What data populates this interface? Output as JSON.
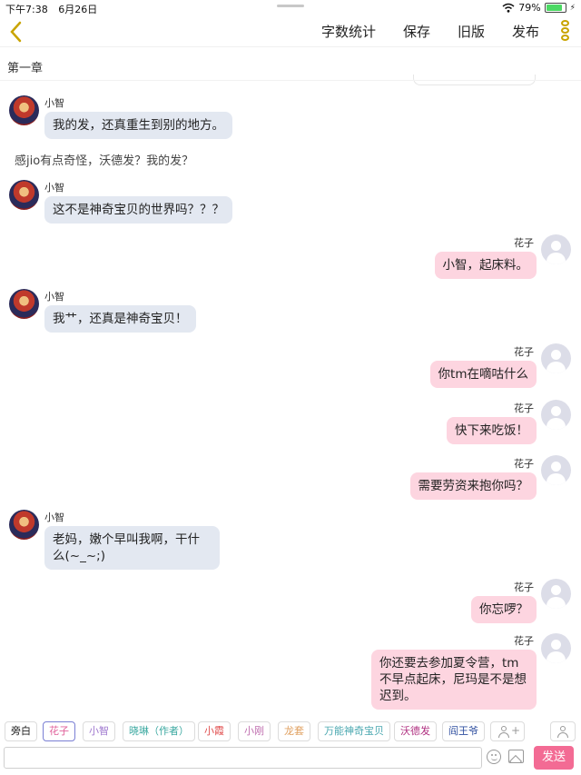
{
  "status_bar": {
    "time": "下午7:38",
    "date": "6月26日",
    "battery_text": "79%",
    "battery_level": 0.79
  },
  "toolbar": {
    "word_count": "字数统计",
    "save": "保存",
    "old_version": "旧版",
    "publish": "发布"
  },
  "chapter_title": "第一章",
  "messages": [
    {
      "side": "left",
      "name": "小智",
      "text": "我的发，还真重生到别的地方。"
    },
    {
      "side": "narration",
      "text": "感jio有点奇怪，沃德发？我的发？"
    },
    {
      "side": "left",
      "name": "小智",
      "text": "这不是神奇宝贝的世界吗？？？"
    },
    {
      "side": "right",
      "name": "花子",
      "text": "小智，起床料。"
    },
    {
      "side": "left",
      "name": "小智",
      "text": "我艹，还真是神奇宝贝！"
    },
    {
      "side": "right",
      "name": "花子",
      "text": "你tm在嘀咕什么"
    },
    {
      "side": "right",
      "name": "花子",
      "text": "快下来吃饭！"
    },
    {
      "side": "right",
      "name": "花子",
      "text": "需要劳资来抱你吗？"
    },
    {
      "side": "left",
      "name": "小智",
      "text": "老妈，嫩个早叫我啊，干什么(~_~;)"
    },
    {
      "side": "right",
      "name": "花子",
      "text": "你忘啰？"
    },
    {
      "side": "right",
      "name": "花子",
      "text": "你还要去参加夏令营，tm不早点起床，尼玛是不是想迟到。"
    }
  ],
  "characters": [
    {
      "label": "旁白",
      "color": "#222222"
    },
    {
      "label": "花子",
      "color": "#e0609a"
    },
    {
      "label": "小智",
      "color": "#a07ad0"
    },
    {
      "label": "晓琳（作者）",
      "color": "#3aa8a0"
    },
    {
      "label": "小霞",
      "color": "#e05050"
    },
    {
      "label": "小刚",
      "color": "#c070b0"
    },
    {
      "label": "龙套",
      "color": "#e0a060"
    },
    {
      "label": "万能神奇宝贝",
      "color": "#4aa8b0"
    },
    {
      "label": "沃德发",
      "color": "#b03080"
    },
    {
      "label": "阎王爷",
      "color": "#3050a0"
    }
  ],
  "input": {
    "placeholder": "",
    "send_label": "发送"
  },
  "colors": {
    "accent_pink": "#f36b94",
    "left_bubble": "#e3e8f1",
    "right_bubble": "#fdd5e0",
    "back_gold": "#c9a400"
  }
}
